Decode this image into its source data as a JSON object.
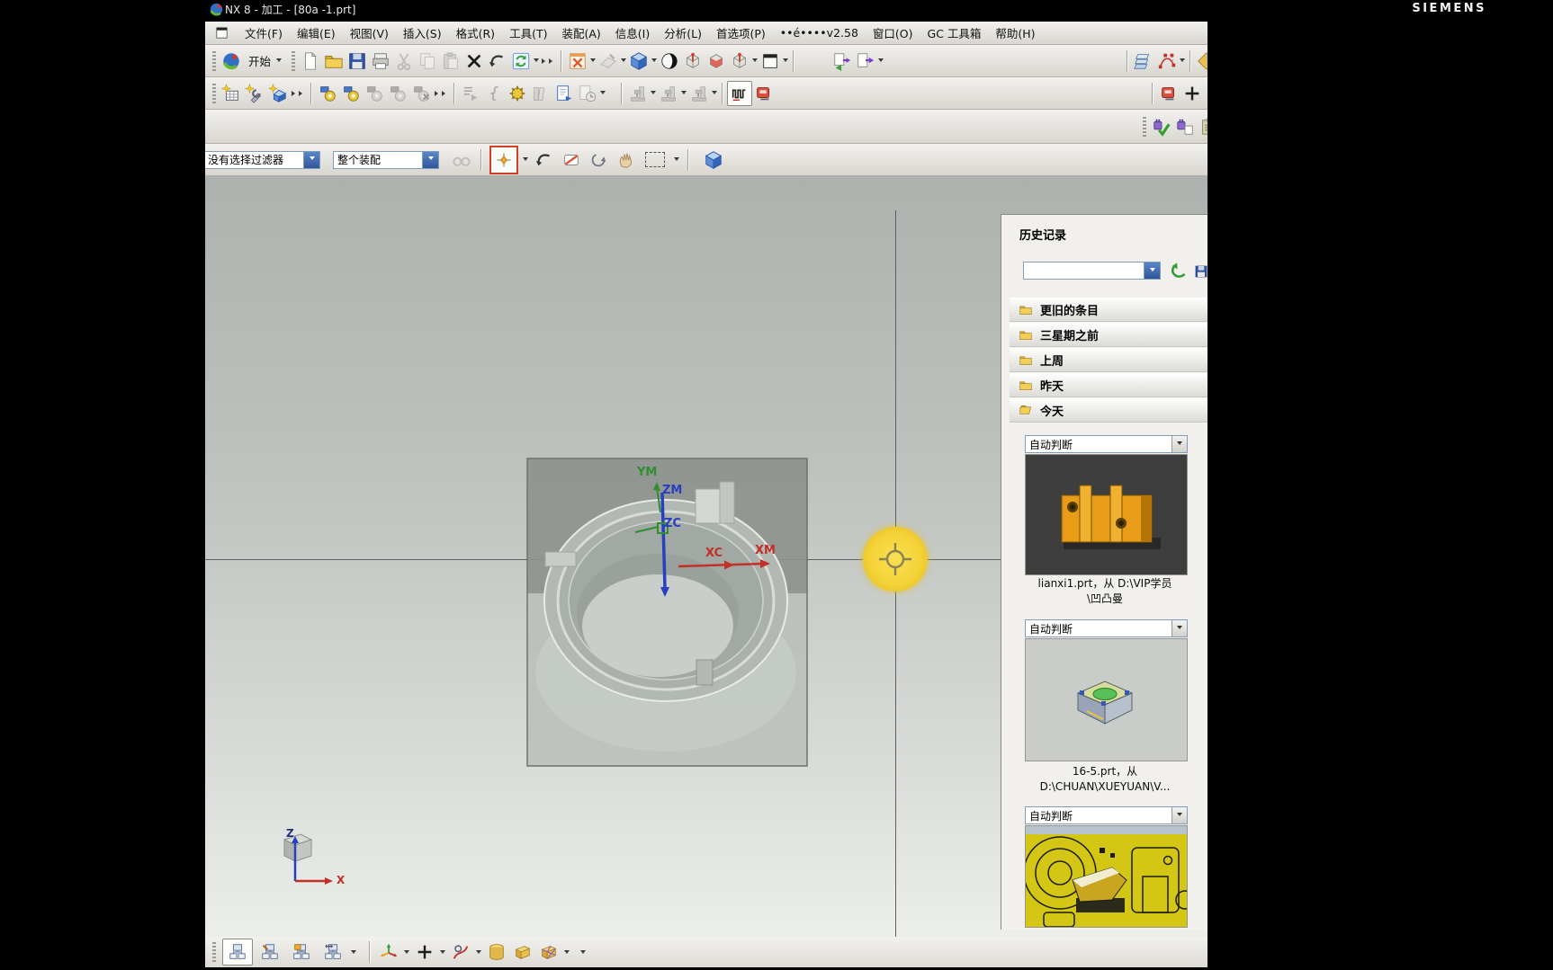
{
  "window": {
    "title": "NX 8 - 加工 - [80a -1.prt]",
    "brand": "SIEMENS"
  },
  "menu": {
    "items": [
      "文件(F)",
      "编辑(E)",
      "视图(V)",
      "插入(S)",
      "格式(R)",
      "工具(T)",
      "装配(A)",
      "信息(I)",
      "分析(L)",
      "首选项(P)",
      "••é••••v2.58",
      "窗口(O)",
      "GC 工具箱",
      "帮助(H)"
    ]
  },
  "toolbars": {
    "start_label": "开始",
    "row1_icons": [
      "nx-logo",
      "start-menu",
      "new-file",
      "open-folder",
      "save",
      "print",
      "cut",
      "copy",
      "paste",
      "delete",
      "undo",
      "refresh",
      "fit-view-window",
      "sketch",
      "shaded-cube",
      "render-style-sphere",
      "section-pin-cube",
      "section-red-cube",
      "section-pin-cube-2",
      "window-display",
      "show-hide-arrows",
      "purple-arrow-doc",
      "layer-settings",
      "spline-edit",
      "gold-diamond-partial"
    ],
    "row2_icons": [
      "create-program",
      "create-tool",
      "create-geometry",
      "operation-colored-1",
      "operation-colored-2",
      "operation-gray-1",
      "operation-gray-2",
      "operation-gray-x",
      "toolpath-list",
      "toolpath-curve",
      "gear-yellow",
      "books",
      "edit-doc-blue",
      "doc-clock",
      "machine-sim-1",
      "machine-sim-2",
      "machine-sim-3",
      "toolpath-wave-pressed",
      "postprocess-red",
      "postprocess-red-2",
      "plus"
    ],
    "row3_icons": [
      "machine-check-green",
      "machine-doc",
      "clipboard-partial"
    ],
    "bottom_icons": [
      "program-order-view",
      "machine-tool-view",
      "geometry-view",
      "method-view",
      "datum-csys",
      "point",
      "drafting",
      "cylinder",
      "block",
      "faceted-cube"
    ]
  },
  "selection_bar": {
    "filter_value": "没有选择过滤器",
    "scope_value": "整个装配",
    "icons": [
      "binoculars",
      "snap-point",
      "undo-selection",
      "erase",
      "orbit",
      "pan-hand",
      "rect-select",
      "show-model-cube"
    ]
  },
  "viewport": {
    "mcs_labels": {
      "ym": "YM",
      "zm": "ZM",
      "zc": "ZC",
      "xc": "XC",
      "xm": "XM"
    },
    "triad_labels": {
      "z": "Z",
      "x": "X"
    }
  },
  "history_panel": {
    "title": "历史记录",
    "search_value": "",
    "folders": [
      {
        "label": "更旧的条目"
      },
      {
        "label": "三星期之前"
      },
      {
        "label": "上周"
      },
      {
        "label": "昨天"
      },
      {
        "label": "今天"
      }
    ],
    "items": [
      {
        "type_label": "自动判断",
        "caption1": "lianxi1.prt，从 D:\\VIP学员",
        "caption2": "\\凹凸曼"
      },
      {
        "type_label": "自动判断",
        "caption1": "16-5.prt，从",
        "caption2": "D:\\CHUAN\\XUEYUAN\\V..."
      },
      {
        "type_label": "自动判断",
        "caption1": "",
        "caption2": ""
      }
    ]
  },
  "colors": {
    "cursor_yellow": "#f2cf2e",
    "axis_green": "#2f8f2f",
    "axis_blue": "#2840c0",
    "axis_red": "#c23028",
    "thumb_dark_bg": "#3e3e3e",
    "thumb_yellow_bg": "#d4c614"
  }
}
